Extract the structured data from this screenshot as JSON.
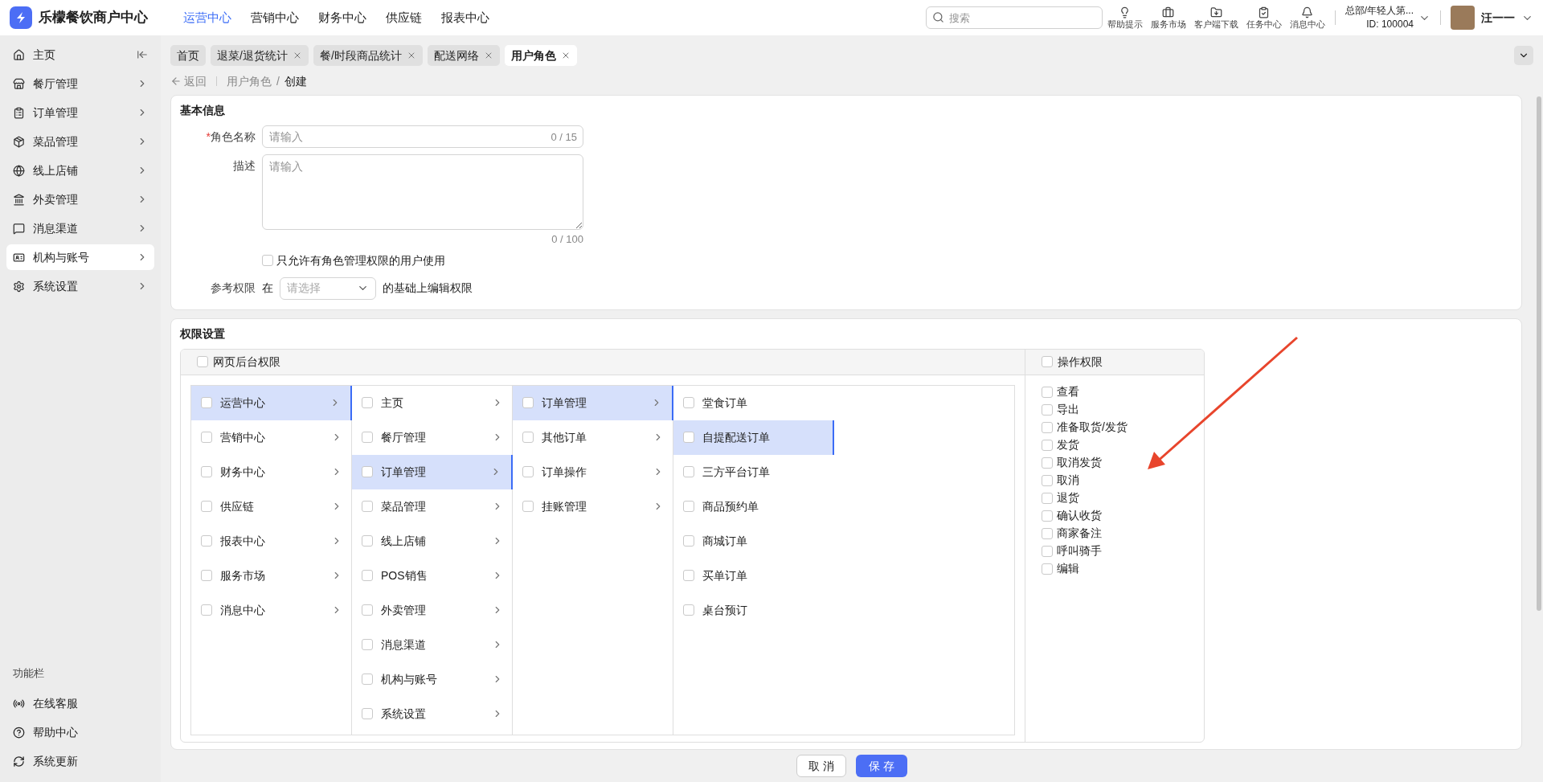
{
  "app": {
    "title": "乐檬餐饮商户中心"
  },
  "top_nav": [
    {
      "label": "运营中心",
      "selected": true
    },
    {
      "label": "营销中心",
      "selected": false
    },
    {
      "label": "财务中心",
      "selected": false
    },
    {
      "label": "供应链",
      "selected": false
    },
    {
      "label": "报表中心",
      "selected": false
    }
  ],
  "search": {
    "placeholder": "搜索"
  },
  "tools": [
    "帮助提示",
    "服务市场",
    "客户端下载",
    "任务中心",
    "消息中心"
  ],
  "org": {
    "name": "总部/年轻人第...",
    "id": "ID: 100004"
  },
  "user": {
    "name": "汪一一"
  },
  "sidebar": {
    "items": [
      {
        "label": "主页",
        "selected": false
      },
      {
        "label": "餐厅管理",
        "selected": false
      },
      {
        "label": "订单管理",
        "selected": false
      },
      {
        "label": "菜品管理",
        "selected": false
      },
      {
        "label": "线上店铺",
        "selected": false
      },
      {
        "label": "外卖管理",
        "selected": false
      },
      {
        "label": "消息渠道",
        "selected": false
      },
      {
        "label": "机构与账号",
        "selected": true
      },
      {
        "label": "系统设置",
        "selected": false
      }
    ],
    "section_title": "功能栏",
    "tools": [
      "在线客服",
      "帮助中心",
      "系统更新"
    ]
  },
  "page_tabs": [
    {
      "label": "首页",
      "selected": false,
      "closable": false
    },
    {
      "label": "退菜/退货统计",
      "selected": false,
      "closable": true
    },
    {
      "label": "餐/时段商品统计",
      "selected": false,
      "closable": true
    },
    {
      "label": "配送网络",
      "selected": false,
      "closable": true
    },
    {
      "label": "用户角色",
      "selected": true,
      "closable": true
    }
  ],
  "breadcrumb": {
    "back": "返回",
    "separator": "/",
    "items": [
      "用户角色",
      "创建"
    ]
  },
  "basic_info": {
    "title": "基本信息",
    "required_mark": "*",
    "name_label": "角色名称",
    "name_placeholder": "请输入",
    "name_count": "0 / 15",
    "desc_label": "描述",
    "desc_placeholder": "请输入",
    "desc_count": "0 / 100",
    "restrict": {
      "label": "只允许有角色管理权限的用户使用",
      "checked": false
    },
    "ref_label": "参考权限",
    "ref_prefix": "在",
    "ref_placeholder": "请选择",
    "ref_suffix": "的基础上编辑权限"
  },
  "permissions": {
    "title": "权限设置",
    "web": {
      "label": "网页后台权限",
      "checked": false
    },
    "ops": {
      "label": "操作权限",
      "checked": false
    },
    "columns": [
      [
        {
          "label": "运营中心",
          "selected": true,
          "checked": false,
          "expandable": true
        },
        {
          "label": "营销中心",
          "selected": false,
          "checked": false,
          "expandable": true
        },
        {
          "label": "财务中心",
          "selected": false,
          "checked": false,
          "expandable": true
        },
        {
          "label": "供应链",
          "selected": false,
          "checked": false,
          "expandable": true
        },
        {
          "label": "报表中心",
          "selected": false,
          "checked": false,
          "expandable": true
        },
        {
          "label": "服务市场",
          "selected": false,
          "checked": false,
          "expandable": true
        },
        {
          "label": "消息中心",
          "selected": false,
          "checked": false,
          "expandable": true
        }
      ],
      [
        {
          "label": "主页",
          "selected": false,
          "checked": false,
          "expandable": true
        },
        {
          "label": "餐厅管理",
          "selected": false,
          "checked": false,
          "expandable": true
        },
        {
          "label": "订单管理",
          "selected": true,
          "checked": false,
          "expandable": true
        },
        {
          "label": "菜品管理",
          "selected": false,
          "checked": false,
          "expandable": true
        },
        {
          "label": "线上店铺",
          "selected": false,
          "checked": false,
          "expandable": true
        },
        {
          "label": "POS销售",
          "selected": false,
          "checked": false,
          "expandable": true
        },
        {
          "label": "外卖管理",
          "selected": false,
          "checked": false,
          "expandable": true
        },
        {
          "label": "消息渠道",
          "selected": false,
          "checked": false,
          "expandable": true
        },
        {
          "label": "机构与账号",
          "selected": false,
          "checked": false,
          "expandable": true
        },
        {
          "label": "系统设置",
          "selected": false,
          "checked": false,
          "expandable": true
        }
      ],
      [
        {
          "label": "订单管理",
          "selected": true,
          "checked": false,
          "expandable": true
        },
        {
          "label": "其他订单",
          "selected": false,
          "checked": false,
          "expandable": true
        },
        {
          "label": "订单操作",
          "selected": false,
          "checked": false,
          "expandable": true
        },
        {
          "label": "挂账管理",
          "selected": false,
          "checked": false,
          "expandable": true
        }
      ],
      [
        {
          "label": "堂食订单",
          "selected": false,
          "checked": false,
          "expandable": false
        },
        {
          "label": "自提配送订单",
          "selected": true,
          "checked": false,
          "expandable": false
        },
        {
          "label": "三方平台订单",
          "selected": false,
          "checked": false,
          "expandable": false
        },
        {
          "label": "商品预约单",
          "selected": false,
          "checked": false,
          "expandable": false
        },
        {
          "label": "商城订单",
          "selected": false,
          "checked": false,
          "expandable": false
        },
        {
          "label": "买单订单",
          "selected": false,
          "checked": false,
          "expandable": false
        },
        {
          "label": "桌台预订",
          "selected": false,
          "checked": false,
          "expandable": false
        }
      ]
    ],
    "actions": [
      {
        "label": "查看",
        "checked": false
      },
      {
        "label": "导出",
        "checked": false
      },
      {
        "label": "准备取货/发货",
        "checked": false
      },
      {
        "label": "发货",
        "checked": false
      },
      {
        "label": "取消发货",
        "checked": false
      },
      {
        "label": "取消",
        "checked": false
      },
      {
        "label": "退货",
        "checked": false
      },
      {
        "label": "确认收货",
        "checked": false
      },
      {
        "label": "商家备注",
        "checked": false
      },
      {
        "label": "呼叫骑手",
        "checked": false
      },
      {
        "label": "编辑",
        "checked": false
      }
    ]
  },
  "footer": {
    "cancel": "取 消",
    "save": "保 存"
  }
}
